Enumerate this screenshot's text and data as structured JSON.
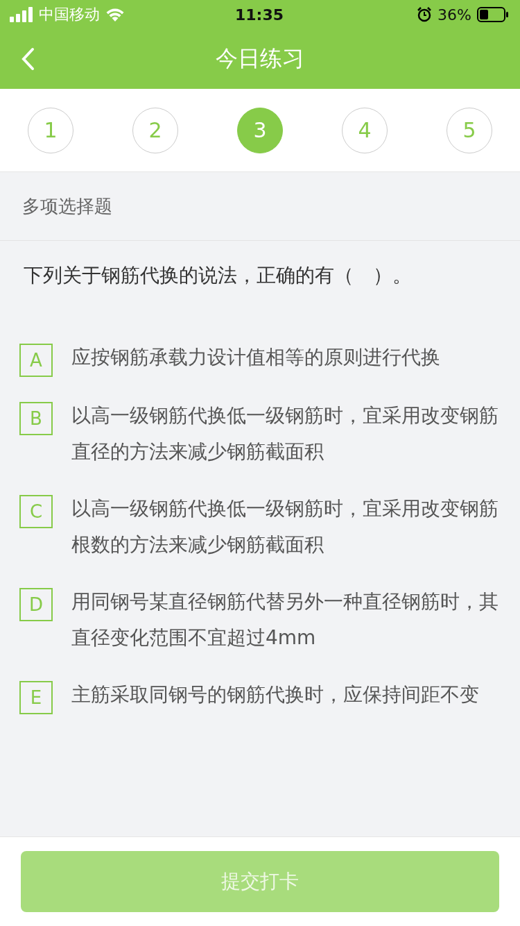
{
  "status_bar": {
    "carrier": "中国移动",
    "time": "11:35",
    "battery": "36%"
  },
  "nav": {
    "title": "今日练习"
  },
  "question_tabs": [
    {
      "label": "1",
      "selected": false
    },
    {
      "label": "2",
      "selected": false
    },
    {
      "label": "3",
      "selected": true
    },
    {
      "label": "4",
      "selected": false
    },
    {
      "label": "5",
      "selected": false
    }
  ],
  "question_type": "多项选择题",
  "question": "下列关于钢筋代换的说法，正确的有（　）。",
  "options": [
    {
      "letter": "A",
      "text": "应按钢筋承载力设计值相等的原则进行代换"
    },
    {
      "letter": "B",
      "text": "以高一级钢筋代换低一级钢筋时，宜采用改变钢筋直径的方法来减少钢筋截面积"
    },
    {
      "letter": "C",
      "text": "以高一级钢筋代换低一级钢筋时，宜采用改变钢筋根数的方法来减少钢筋截面积"
    },
    {
      "letter": "D",
      "text": "用同钢号某直径钢筋代替另外一种直径钢筋时，其直径变化范围不宜超过4mm"
    },
    {
      "letter": "E",
      "text": "主筋采取同钢号的钢筋代换时，应保持间距不变"
    }
  ],
  "submit": {
    "label": "提交打卡",
    "disabled": true
  }
}
